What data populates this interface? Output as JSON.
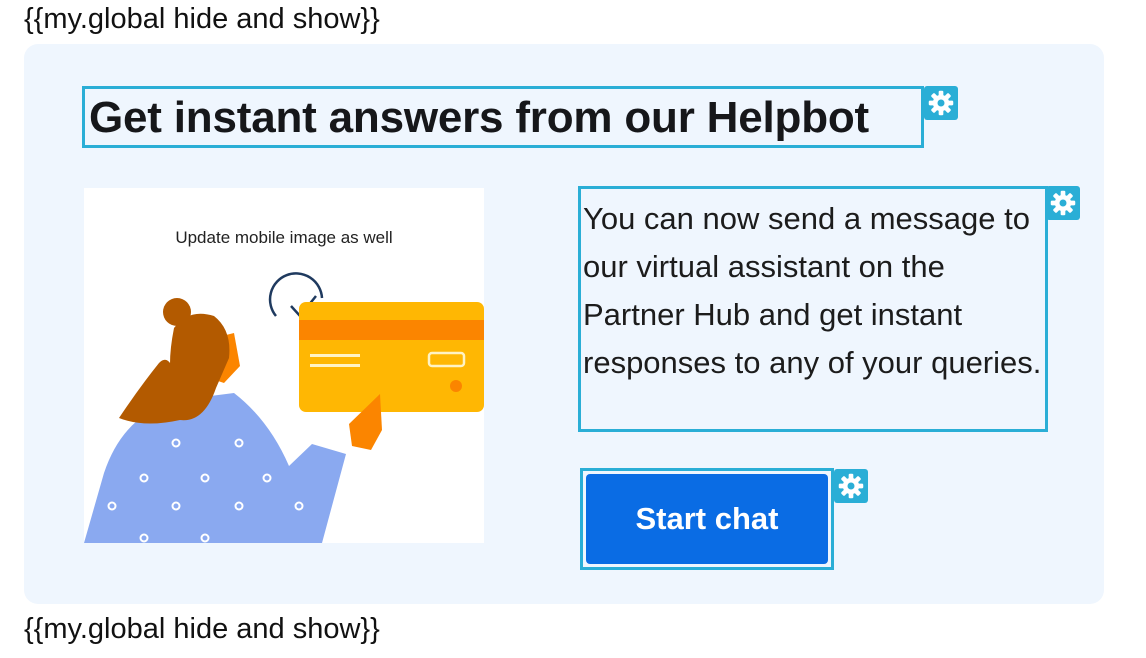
{
  "template_token": "{{my.global hide and show}}",
  "card": {
    "heading": "Get instant answers from our Helpbot",
    "image_caption": "Update mobile image as well",
    "body": "You can now send a message to our virtual assistant on the Partner Hub and get instant responses to any of your queries.",
    "button_label": "Start chat"
  },
  "icons": {
    "edit": "gear-icon"
  },
  "colors": {
    "card_background": "#eff6fe",
    "edit_outline": "#2aaed6",
    "button": "#0a6ce4",
    "card_illustration": "#ffb703",
    "card_stripe": "#fb8500",
    "sweater": "#8aa9f0",
    "hair": "#b35a00"
  }
}
